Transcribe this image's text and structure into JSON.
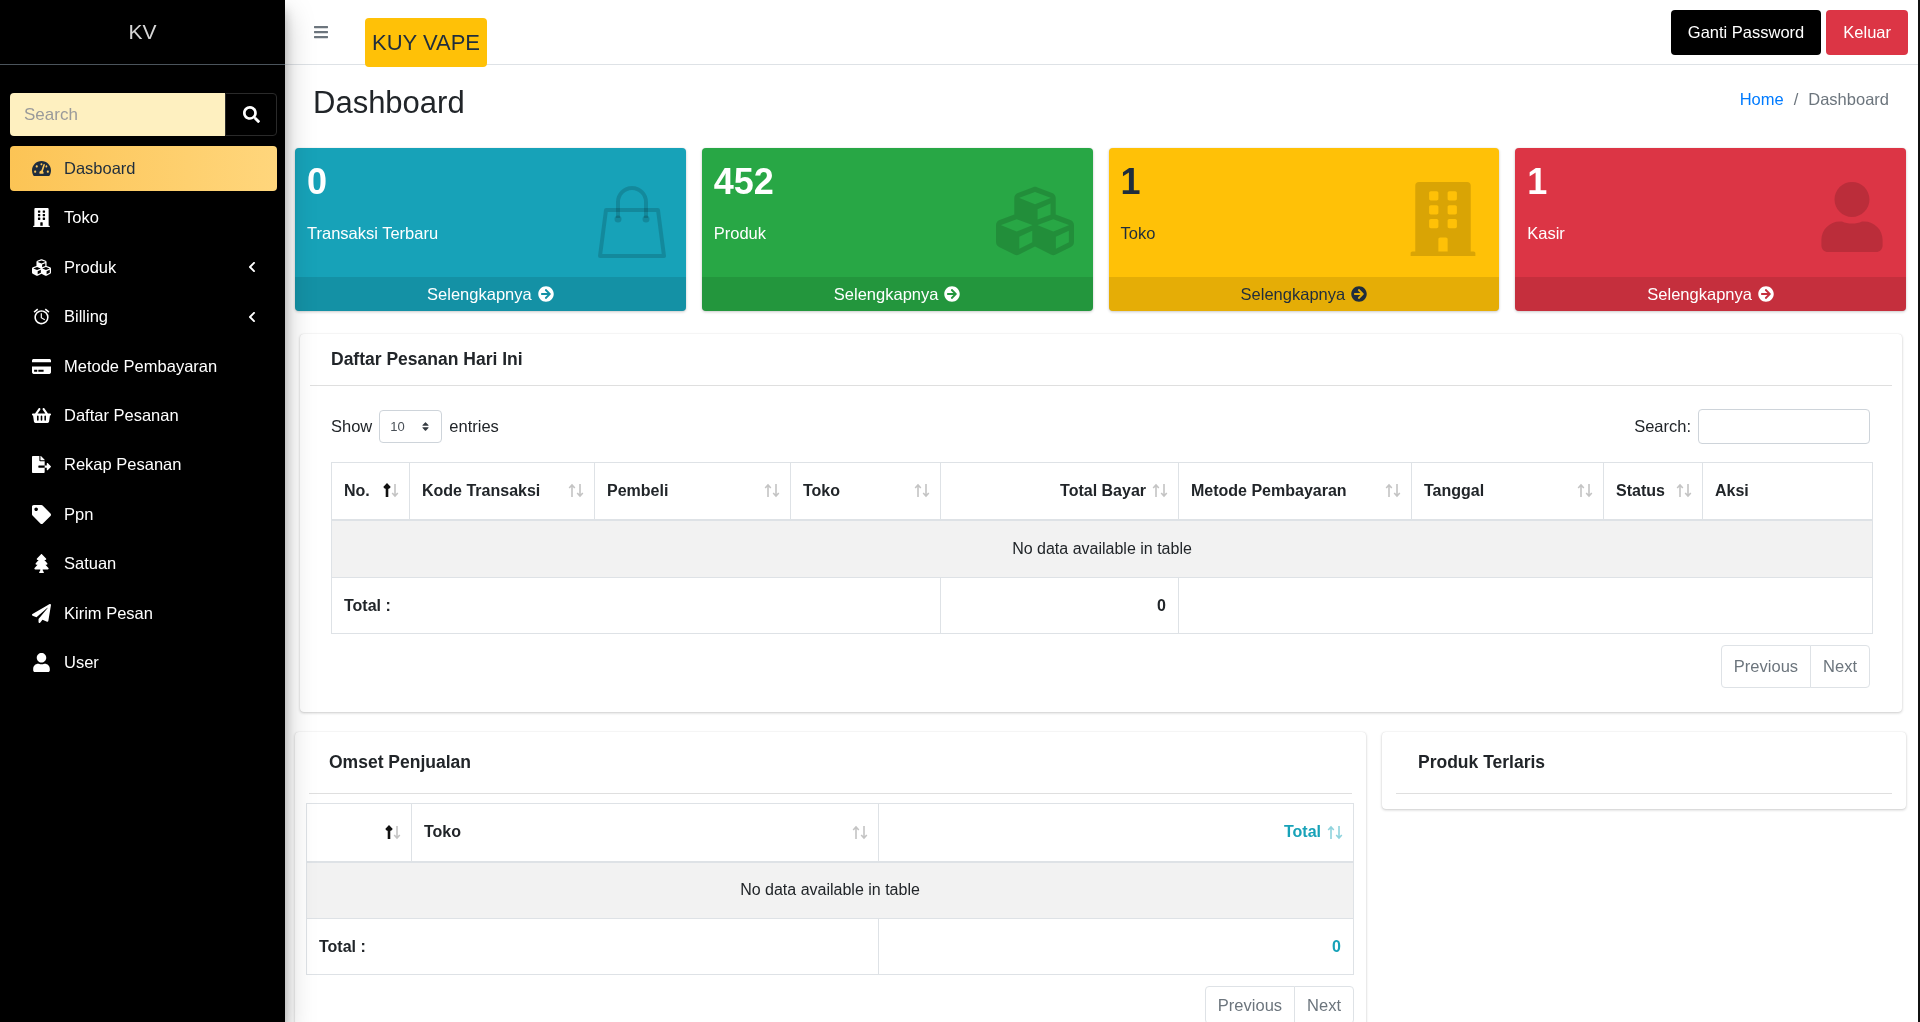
{
  "sidebar": {
    "brand": "KV",
    "search": {
      "placeholder": "Search"
    },
    "items": [
      {
        "label": "Dasboard",
        "selected": true,
        "has_submenu": false
      },
      {
        "label": "Toko",
        "selected": false,
        "has_submenu": false
      },
      {
        "label": "Produk",
        "selected": false,
        "has_submenu": true
      },
      {
        "label": "Billing",
        "selected": false,
        "has_submenu": true
      },
      {
        "label": "Metode Pembayaran",
        "selected": false,
        "has_submenu": false
      },
      {
        "label": "Daftar Pesanan",
        "selected": false,
        "has_submenu": false
      },
      {
        "label": "Rekap Pesanan",
        "selected": false,
        "has_submenu": false
      },
      {
        "label": "Ppn",
        "selected": false,
        "has_submenu": false
      },
      {
        "label": "Satuan",
        "selected": false,
        "has_submenu": false
      },
      {
        "label": "Kirim Pesan",
        "selected": false,
        "has_submenu": false
      },
      {
        "label": "User",
        "selected": false,
        "has_submenu": false
      }
    ]
  },
  "navbar": {
    "brand_badge": "KUY VAPE",
    "buttons": [
      {
        "label": "Ganti Password",
        "kind": "dark"
      },
      {
        "label": "Keluar",
        "kind": "danger"
      }
    ]
  },
  "page_header": {
    "title": "Dashboard",
    "breadcrumb": {
      "separator": "/",
      "items": [
        {
          "label": "Home",
          "link": true
        },
        {
          "label": "Dashboard",
          "link": false
        }
      ]
    }
  },
  "stat_cards": [
    {
      "value": "0",
      "label": "Transaksi Terbaru",
      "link_label": "Selengkapnya",
      "color": "#17a2b8"
    },
    {
      "value": "452",
      "label": "Produk",
      "link_label": "Selengkapnya",
      "color": "#28a745"
    },
    {
      "value": "1",
      "label": "Toko",
      "link_label": "Selengkapnya",
      "color": "#ffc107"
    },
    {
      "value": "1",
      "label": "Kasir",
      "link_label": "Selengkapnya",
      "color": "#dc3545"
    }
  ],
  "orders_panel": {
    "title": "Daftar Pesanan Hari Ini",
    "length_menu": {
      "before": "Show",
      "value": "10",
      "after": "entries"
    },
    "search": {
      "label": "Search:"
    },
    "table": {
      "columns": [
        {
          "label": "No.",
          "kind": "text",
          "sortable": true,
          "sorted": true,
          "accent": false
        },
        {
          "label": "Kode Transaksi",
          "kind": "text",
          "sortable": true,
          "sorted": false,
          "accent": false
        },
        {
          "label": "Pembeli",
          "kind": "text",
          "sortable": true,
          "sorted": false,
          "accent": false
        },
        {
          "label": "Toko",
          "kind": "text",
          "sortable": true,
          "sorted": false,
          "accent": false
        },
        {
          "label": "Total Bayar",
          "kind": "amount",
          "sortable": true,
          "sorted": false,
          "accent": false
        },
        {
          "label": "Metode Pembayaran",
          "kind": "text",
          "sortable": true,
          "sorted": false,
          "accent": false
        },
        {
          "label": "Tanggal",
          "kind": "text",
          "sortable": true,
          "sorted": false,
          "accent": false
        },
        {
          "label": "Status",
          "kind": "text",
          "sortable": true,
          "sorted": false,
          "accent": false
        },
        {
          "label": "Aksi",
          "kind": "text",
          "sortable": false,
          "accent": false
        }
      ],
      "empty_message": "No data available in table",
      "total_row": {
        "label": "Total :",
        "value": "0"
      }
    },
    "pagination": [
      {
        "label": "Previous",
        "disabled": true
      },
      {
        "label": "Next",
        "disabled": true
      }
    ]
  },
  "sales_panel": {
    "title": "Omset Penjualan",
    "table": {
      "columns": [
        {
          "kind": "text",
          "sortable": true,
          "sorted": true,
          "accent": false
        },
        {
          "label": "Toko",
          "kind": "text",
          "sortable": true,
          "sorted": false,
          "accent": false
        },
        {
          "label": "Total",
          "kind": "amount",
          "sortable": true,
          "sorted": false,
          "accent": true
        }
      ],
      "empty_message": "No data available in table",
      "total_row": {
        "label": "Total :",
        "value": "0"
      }
    },
    "pagination": [
      {
        "label": "Previous",
        "disabled": true
      },
      {
        "label": "Next",
        "disabled": true
      }
    ]
  },
  "best_sellers_panel": {
    "title": "Produk Terlaris"
  }
}
